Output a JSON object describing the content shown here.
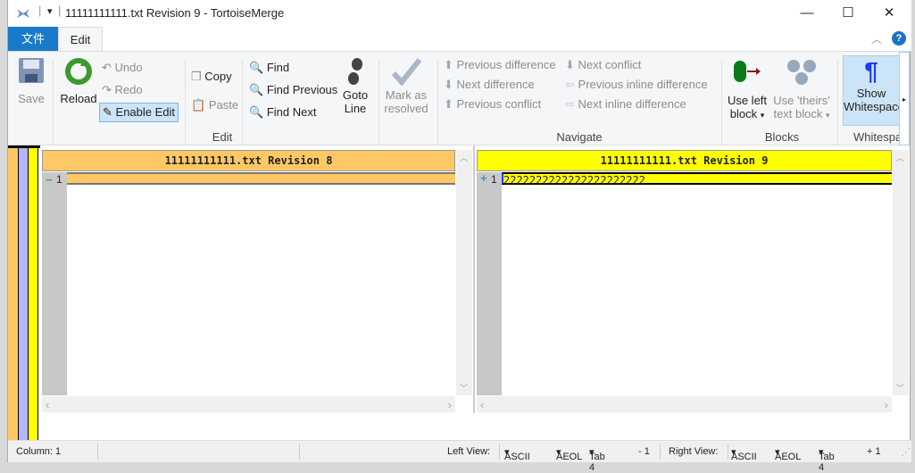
{
  "window": {
    "title": "11111111111.txt Revision 9 - TortoiseMerge",
    "minimize": "—",
    "maximize": "☐",
    "close": "✕"
  },
  "tabs": [
    {
      "label": "文件"
    },
    {
      "label": "Edit"
    }
  ],
  "ribbon": {
    "edit_group": {
      "save": "Save",
      "reload": "Reload",
      "undo": "Undo",
      "redo": "Redo",
      "enable_edit": "Enable Edit",
      "copy": "Copy",
      "paste": "Paste",
      "find": "Find",
      "find_previous": "Find Previous",
      "find_next": "Find Next",
      "goto_line_1": "Goto",
      "goto_line_2": "Line",
      "mark_1": "Mark as",
      "mark_2": "resolved",
      "label": "Edit"
    },
    "navigate_group": {
      "prev_diff": "Previous difference",
      "next_diff": "Next difference",
      "prev_conflict": "Previous conflict",
      "next_conflict": "Next conflict",
      "prev_inline": "Previous inline difference",
      "next_inline": "Next inline difference",
      "label": "Navigate"
    },
    "blocks_group": {
      "use_left_1": "Use left",
      "use_left_2": "block",
      "use_theirs_1": "Use 'theirs'",
      "use_theirs_2": "text block",
      "label": "Blocks"
    },
    "whitespace_group": {
      "show_1": "Show",
      "show_2": "Whitespace",
      "label": "Whitespace"
    }
  },
  "left_view": {
    "header": "11111111111.txt Revision 8",
    "lines": [
      {
        "marker": "−",
        "number": "1",
        "text": ""
      }
    ],
    "color": "#ffc864"
  },
  "right_view": {
    "header": "11111111111.txt Revision 9",
    "lines": [
      {
        "marker": "+",
        "number": "1",
        "text": "2222222222222222222222"
      }
    ],
    "color": "#ffff00"
  },
  "status": {
    "column": "Column: 1",
    "left_view_label": "Left View:",
    "left_encoding": "ASCII",
    "left_eol": "AEOL",
    "left_tab": "Tab 4",
    "left_count": "- 1",
    "right_view_label": "Right View:",
    "right_encoding": "ASCII",
    "right_eol": "AEOL",
    "right_tab": "Tab 4",
    "right_count": "+ 1"
  }
}
